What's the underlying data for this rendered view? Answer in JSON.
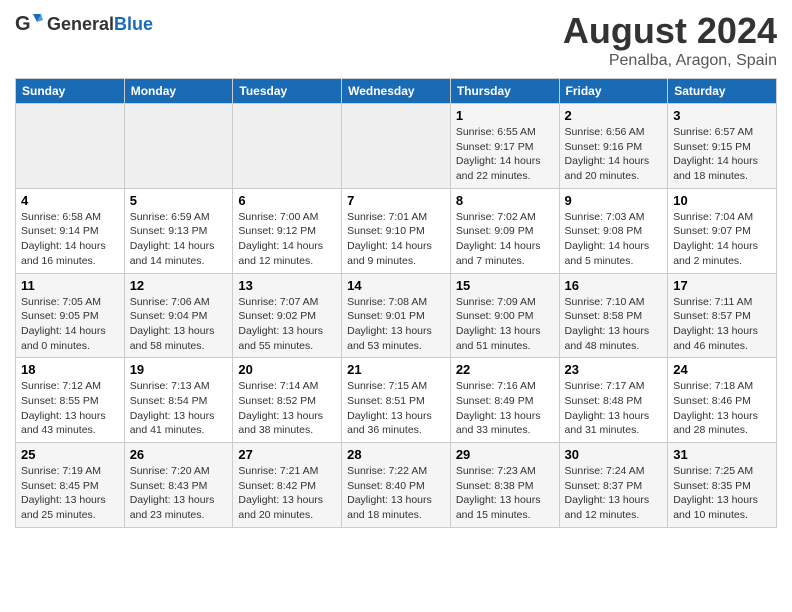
{
  "header": {
    "logo_general": "General",
    "logo_blue": "Blue",
    "title": "August 2024",
    "subtitle": "Penalba, Aragon, Spain"
  },
  "days_of_week": [
    "Sunday",
    "Monday",
    "Tuesday",
    "Wednesday",
    "Thursday",
    "Friday",
    "Saturday"
  ],
  "weeks": [
    [
      {
        "day": "",
        "info": ""
      },
      {
        "day": "",
        "info": ""
      },
      {
        "day": "",
        "info": ""
      },
      {
        "day": "",
        "info": ""
      },
      {
        "day": "1",
        "info": "Sunrise: 6:55 AM\nSunset: 9:17 PM\nDaylight: 14 hours\nand 22 minutes."
      },
      {
        "day": "2",
        "info": "Sunrise: 6:56 AM\nSunset: 9:16 PM\nDaylight: 14 hours\nand 20 minutes."
      },
      {
        "day": "3",
        "info": "Sunrise: 6:57 AM\nSunset: 9:15 PM\nDaylight: 14 hours\nand 18 minutes."
      }
    ],
    [
      {
        "day": "4",
        "info": "Sunrise: 6:58 AM\nSunset: 9:14 PM\nDaylight: 14 hours\nand 16 minutes."
      },
      {
        "day": "5",
        "info": "Sunrise: 6:59 AM\nSunset: 9:13 PM\nDaylight: 14 hours\nand 14 minutes."
      },
      {
        "day": "6",
        "info": "Sunrise: 7:00 AM\nSunset: 9:12 PM\nDaylight: 14 hours\nand 12 minutes."
      },
      {
        "day": "7",
        "info": "Sunrise: 7:01 AM\nSunset: 9:10 PM\nDaylight: 14 hours\nand 9 minutes."
      },
      {
        "day": "8",
        "info": "Sunrise: 7:02 AM\nSunset: 9:09 PM\nDaylight: 14 hours\nand 7 minutes."
      },
      {
        "day": "9",
        "info": "Sunrise: 7:03 AM\nSunset: 9:08 PM\nDaylight: 14 hours\nand 5 minutes."
      },
      {
        "day": "10",
        "info": "Sunrise: 7:04 AM\nSunset: 9:07 PM\nDaylight: 14 hours\nand 2 minutes."
      }
    ],
    [
      {
        "day": "11",
        "info": "Sunrise: 7:05 AM\nSunset: 9:05 PM\nDaylight: 14 hours\nand 0 minutes."
      },
      {
        "day": "12",
        "info": "Sunrise: 7:06 AM\nSunset: 9:04 PM\nDaylight: 13 hours\nand 58 minutes."
      },
      {
        "day": "13",
        "info": "Sunrise: 7:07 AM\nSunset: 9:02 PM\nDaylight: 13 hours\nand 55 minutes."
      },
      {
        "day": "14",
        "info": "Sunrise: 7:08 AM\nSunset: 9:01 PM\nDaylight: 13 hours\nand 53 minutes."
      },
      {
        "day": "15",
        "info": "Sunrise: 7:09 AM\nSunset: 9:00 PM\nDaylight: 13 hours\nand 51 minutes."
      },
      {
        "day": "16",
        "info": "Sunrise: 7:10 AM\nSunset: 8:58 PM\nDaylight: 13 hours\nand 48 minutes."
      },
      {
        "day": "17",
        "info": "Sunrise: 7:11 AM\nSunset: 8:57 PM\nDaylight: 13 hours\nand 46 minutes."
      }
    ],
    [
      {
        "day": "18",
        "info": "Sunrise: 7:12 AM\nSunset: 8:55 PM\nDaylight: 13 hours\nand 43 minutes."
      },
      {
        "day": "19",
        "info": "Sunrise: 7:13 AM\nSunset: 8:54 PM\nDaylight: 13 hours\nand 41 minutes."
      },
      {
        "day": "20",
        "info": "Sunrise: 7:14 AM\nSunset: 8:52 PM\nDaylight: 13 hours\nand 38 minutes."
      },
      {
        "day": "21",
        "info": "Sunrise: 7:15 AM\nSunset: 8:51 PM\nDaylight: 13 hours\nand 36 minutes."
      },
      {
        "day": "22",
        "info": "Sunrise: 7:16 AM\nSunset: 8:49 PM\nDaylight: 13 hours\nand 33 minutes."
      },
      {
        "day": "23",
        "info": "Sunrise: 7:17 AM\nSunset: 8:48 PM\nDaylight: 13 hours\nand 31 minutes."
      },
      {
        "day": "24",
        "info": "Sunrise: 7:18 AM\nSunset: 8:46 PM\nDaylight: 13 hours\nand 28 minutes."
      }
    ],
    [
      {
        "day": "25",
        "info": "Sunrise: 7:19 AM\nSunset: 8:45 PM\nDaylight: 13 hours\nand 25 minutes."
      },
      {
        "day": "26",
        "info": "Sunrise: 7:20 AM\nSunset: 8:43 PM\nDaylight: 13 hours\nand 23 minutes."
      },
      {
        "day": "27",
        "info": "Sunrise: 7:21 AM\nSunset: 8:42 PM\nDaylight: 13 hours\nand 20 minutes."
      },
      {
        "day": "28",
        "info": "Sunrise: 7:22 AM\nSunset: 8:40 PM\nDaylight: 13 hours\nand 18 minutes."
      },
      {
        "day": "29",
        "info": "Sunrise: 7:23 AM\nSunset: 8:38 PM\nDaylight: 13 hours\nand 15 minutes."
      },
      {
        "day": "30",
        "info": "Sunrise: 7:24 AM\nSunset: 8:37 PM\nDaylight: 13 hours\nand 12 minutes."
      },
      {
        "day": "31",
        "info": "Sunrise: 7:25 AM\nSunset: 8:35 PM\nDaylight: 13 hours\nand 10 minutes."
      }
    ]
  ]
}
